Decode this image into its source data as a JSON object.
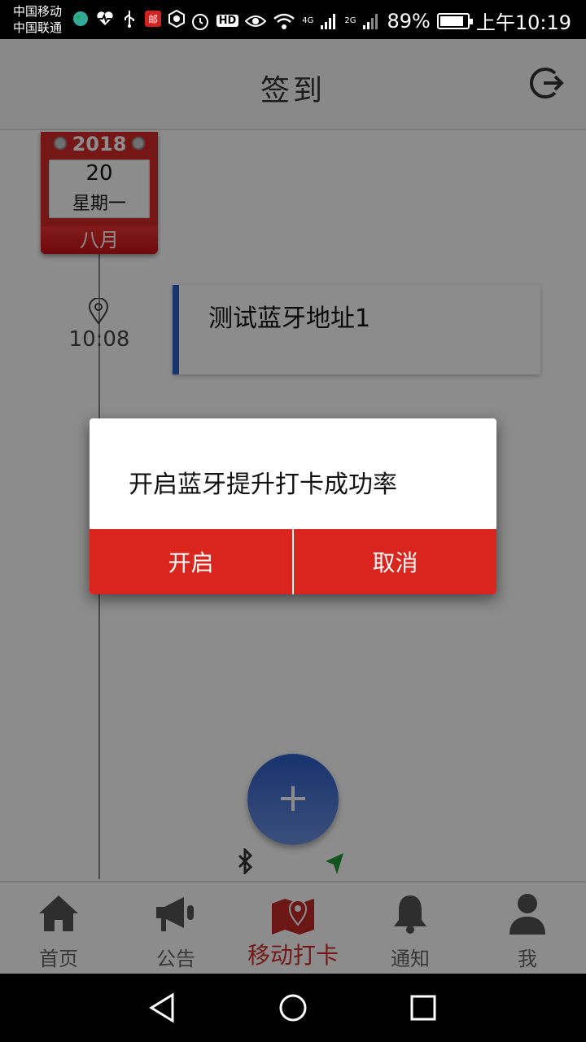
{
  "status_bar": {
    "carrier_1": "中国移动",
    "carrier_2": "中国联通",
    "icons_left": [
      "globe-icon",
      "heartbeat-icon",
      "usb-icon",
      "mail-app-icon",
      "app-icon"
    ],
    "mail_glyph": "邮",
    "hd_label": "HD",
    "net_4g": "4G",
    "net_2g": "2G",
    "battery_percent": "89%",
    "battery_level": 0.89,
    "time": "上午10:19"
  },
  "header": {
    "title": "签到",
    "logout_icon": "logout-icon"
  },
  "calendar": {
    "year": "2018",
    "day": "20",
    "weekday": "星期一",
    "month": "八月"
  },
  "entries": [
    {
      "time": "10:08",
      "title": "测试蓝牙地址1",
      "accent": "#2c63c9"
    }
  ],
  "fab": {
    "label": "+"
  },
  "dialog": {
    "message": "开启蓝牙提升打卡成功率",
    "confirm": "开启",
    "cancel": "取消",
    "button_color": "#d9251d"
  },
  "tabs": [
    {
      "label": "首页",
      "icon": "home-icon",
      "active": false
    },
    {
      "label": "公告",
      "icon": "megaphone-icon",
      "active": false
    },
    {
      "label": "移动打卡",
      "icon": "map-pin-icon",
      "active": true
    },
    {
      "label": "通知",
      "icon": "bell-icon",
      "active": false
    },
    {
      "label": "我",
      "icon": "person-icon",
      "active": false
    }
  ],
  "colors": {
    "active_tab": "#d32f2f",
    "inactive_tab": "#666666"
  }
}
